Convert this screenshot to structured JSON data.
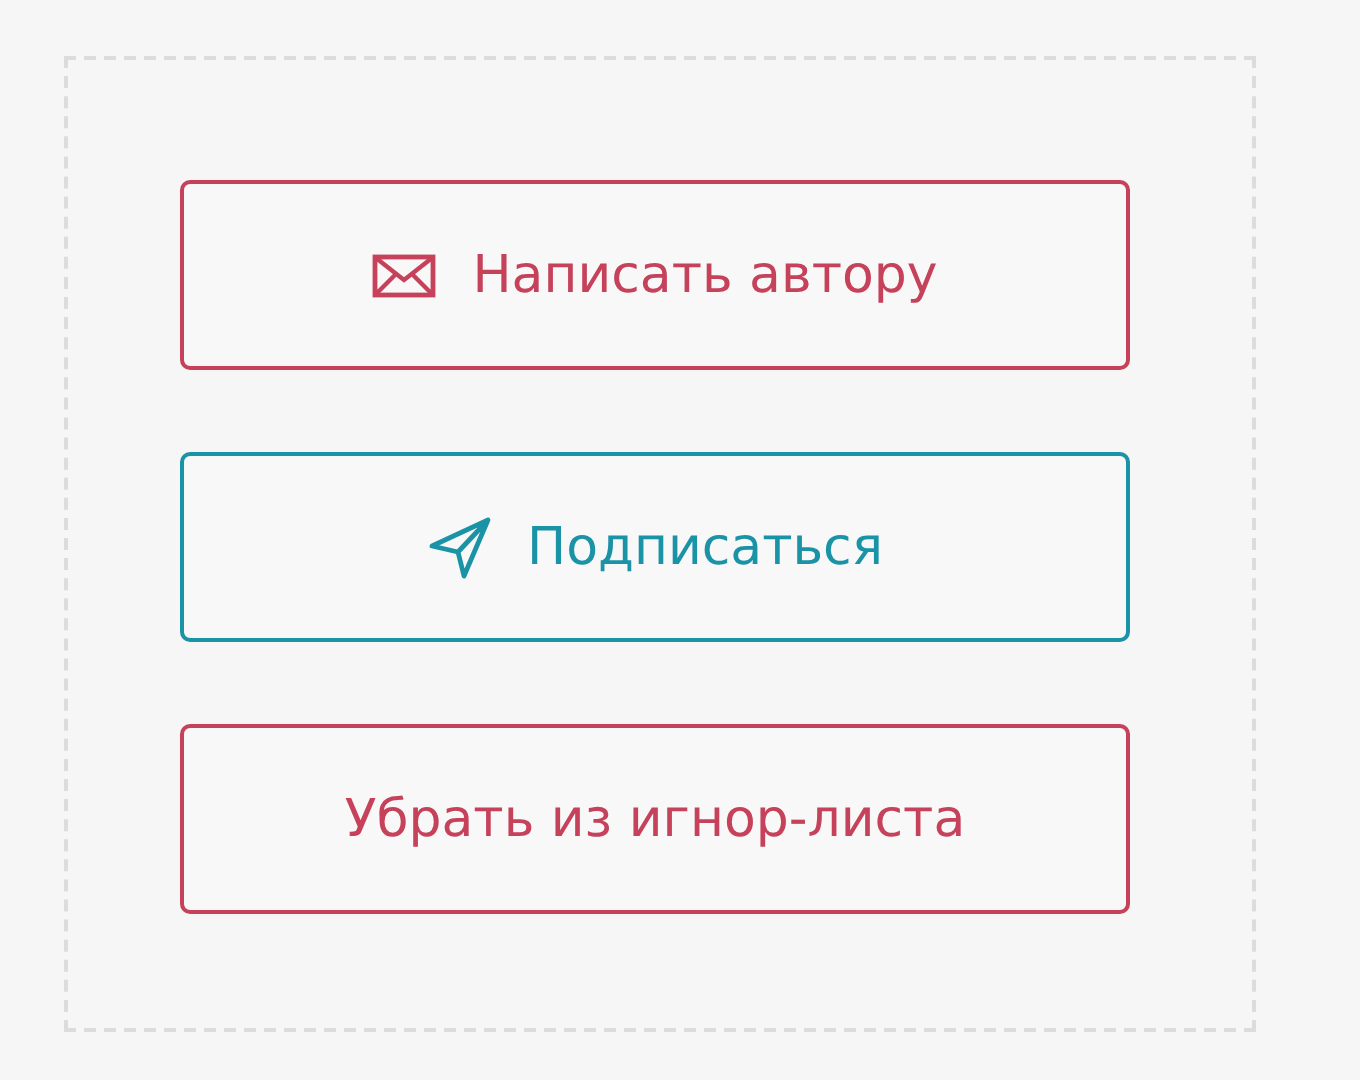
{
  "buttons": [
    {
      "kind": "mail",
      "label": "Написать автору",
      "color": "#c6425b"
    },
    {
      "kind": "send",
      "label": "Подписаться",
      "color": "#1b93a6"
    },
    {
      "kind": "plain",
      "label": "Убрать из игнор-листа",
      "color": "#c6425b"
    }
  ]
}
